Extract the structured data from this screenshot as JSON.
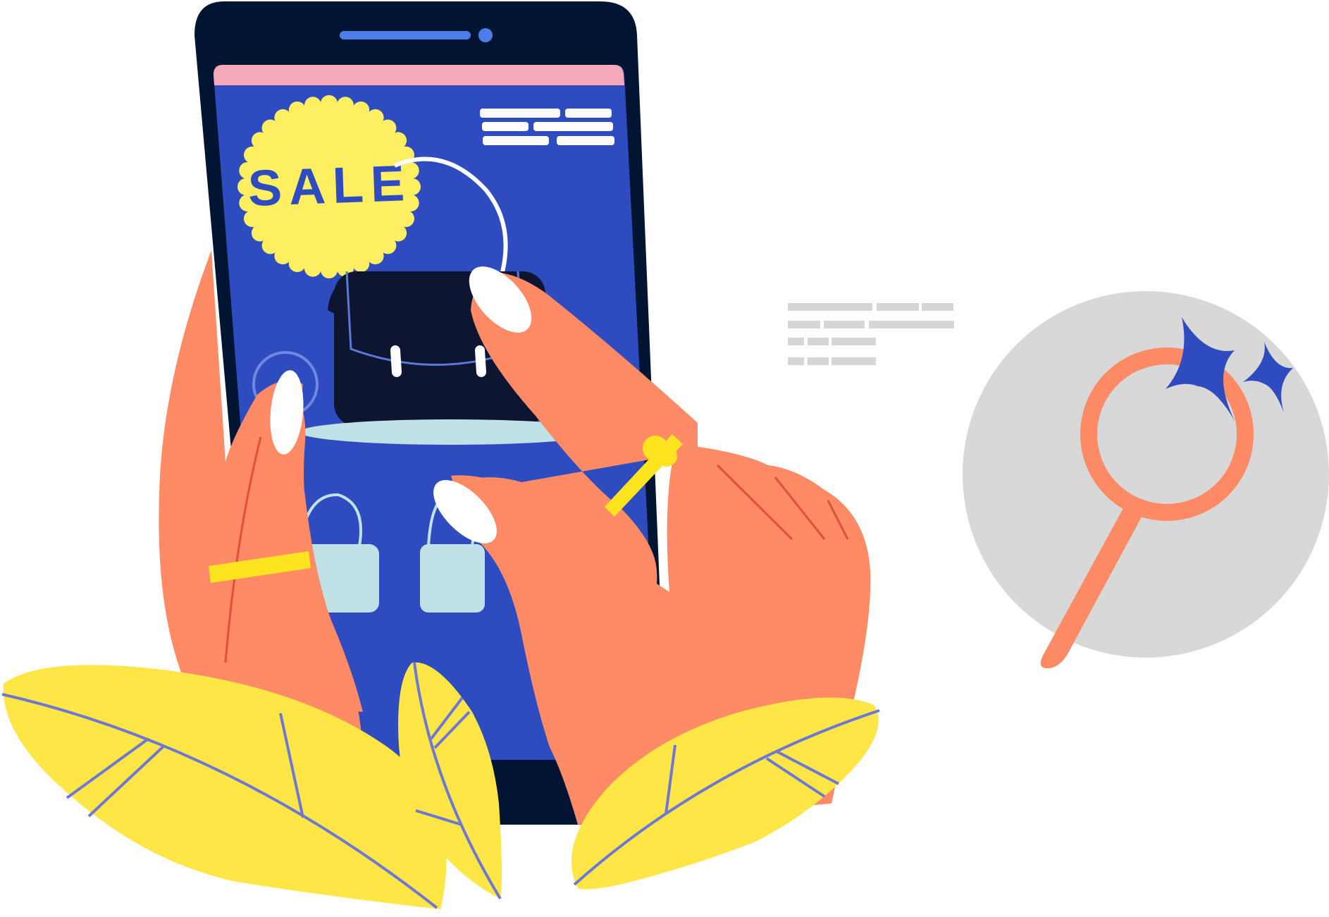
{
  "promo": {
    "badge_text": "SALE"
  },
  "colors": {
    "phone_body": "#011533",
    "screen": "#2e4cc0",
    "status_bar": "#f5a9b8",
    "badge": "#feef62",
    "skin": "#ff8a66",
    "leaf": "#fee646",
    "leaf_vein": "#6e78d4",
    "bag_dark": "#0d1530",
    "bag_light": "#c0e2e6",
    "magnifier_bg": "#d8d8d8",
    "magnifier": "#ff8a66",
    "sparkle": "#2e4cc0",
    "placeholder_lines": "#d6d6d6",
    "ring": "#fee41f"
  },
  "icons": {
    "magnifier": "magnifier-icon",
    "sparkle": "sparkle-icon",
    "bag": "shopping-bag-icon"
  }
}
